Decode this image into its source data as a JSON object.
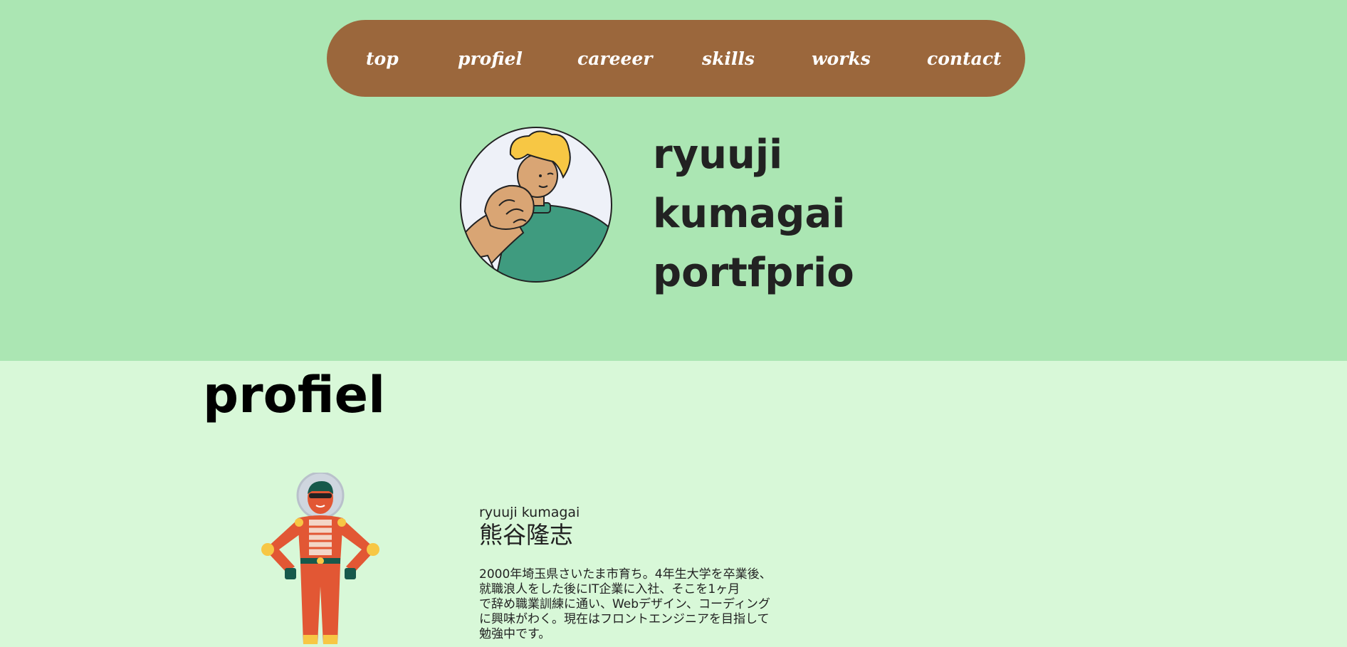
{
  "nav": {
    "items": [
      {
        "label": "top"
      },
      {
        "label": "profiel"
      },
      {
        "label": "careeer"
      },
      {
        "label": "skills"
      },
      {
        "label": "works"
      },
      {
        "label": "contact"
      }
    ]
  },
  "hero": {
    "title_lines": [
      "ryuuji",
      "kumagai",
      "portfprio"
    ],
    "avatar_icon": "man-thinking-avatar-icon"
  },
  "profile": {
    "section_title": "profiel",
    "name_roman": "ryuuji kumagai",
    "name_kanji": "熊谷隆志",
    "bio_lines": [
      "2000年埼玉県さいたま市育ち。4年生大学を卒業後、",
      "就職浪人をした後にIT企業に入社、そこを1ヶ月",
      "で辞め職業訓練に通い、Webデザイン、コーディング",
      "に興味がわく。現在はフロントエンジニアを目指して",
      "勉強中です。"
    ],
    "illustration_icon": "astronaut-icon"
  },
  "colors": {
    "hero_bg": "#abe6b3",
    "body_bg": "#d8f8d8",
    "nav_bg": "#9b673c",
    "nav_text": "#ffffff",
    "title_text": "#222222"
  }
}
